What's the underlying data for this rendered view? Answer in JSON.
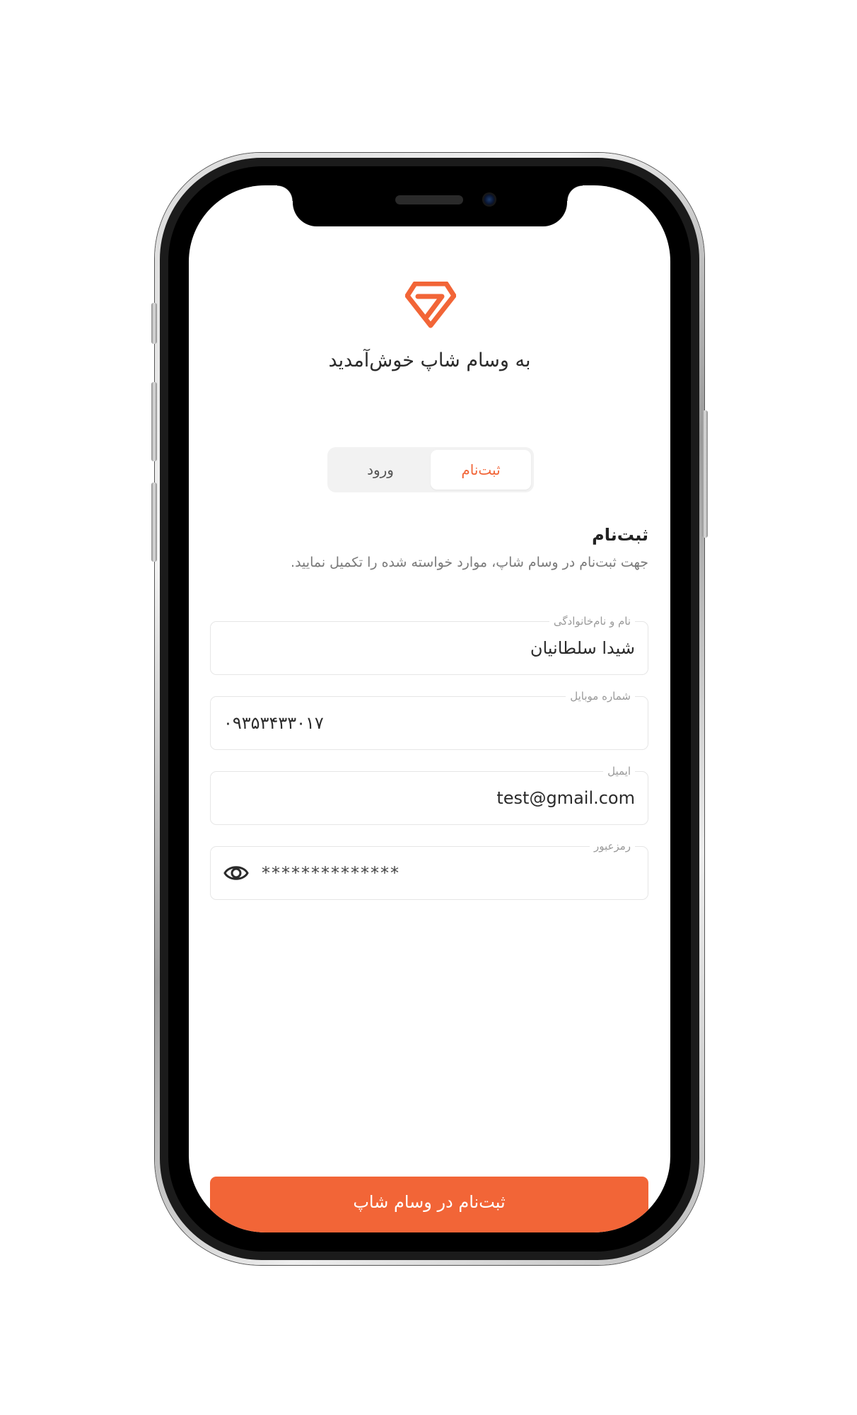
{
  "header": {
    "welcome_text": "به وسام شاپ خوش‌آمدید"
  },
  "tabs": [
    {
      "label": "ثبت‌نام",
      "active": true
    },
    {
      "label": "ورود",
      "active": false
    }
  ],
  "form": {
    "title": "ثبت‌نام",
    "description": "جهت ثبت‌نام در وسام شاپ، موارد خواسته شده را تکمیل نمایید.",
    "fields": {
      "full_name": {
        "label": "نام و نام‌خانوادگی",
        "value": "شیدا سلطانیان"
      },
      "mobile": {
        "label": "شماره موبایل",
        "value": "۰۹۳۵۳۴۳۳۰۱۷"
      },
      "email": {
        "label": "ایمیل",
        "value": "test@gmail.com"
      },
      "password": {
        "label": "رمزعبور",
        "value": "**************"
      }
    },
    "submit_label": "ثبت‌نام در وسام شاپ"
  },
  "colors": {
    "accent": "#f26537",
    "text": "#2b2b2b",
    "muted": "#9a9a9a"
  },
  "icons": {
    "logo": "diamond-logo",
    "password_toggle": "eye-icon"
  }
}
